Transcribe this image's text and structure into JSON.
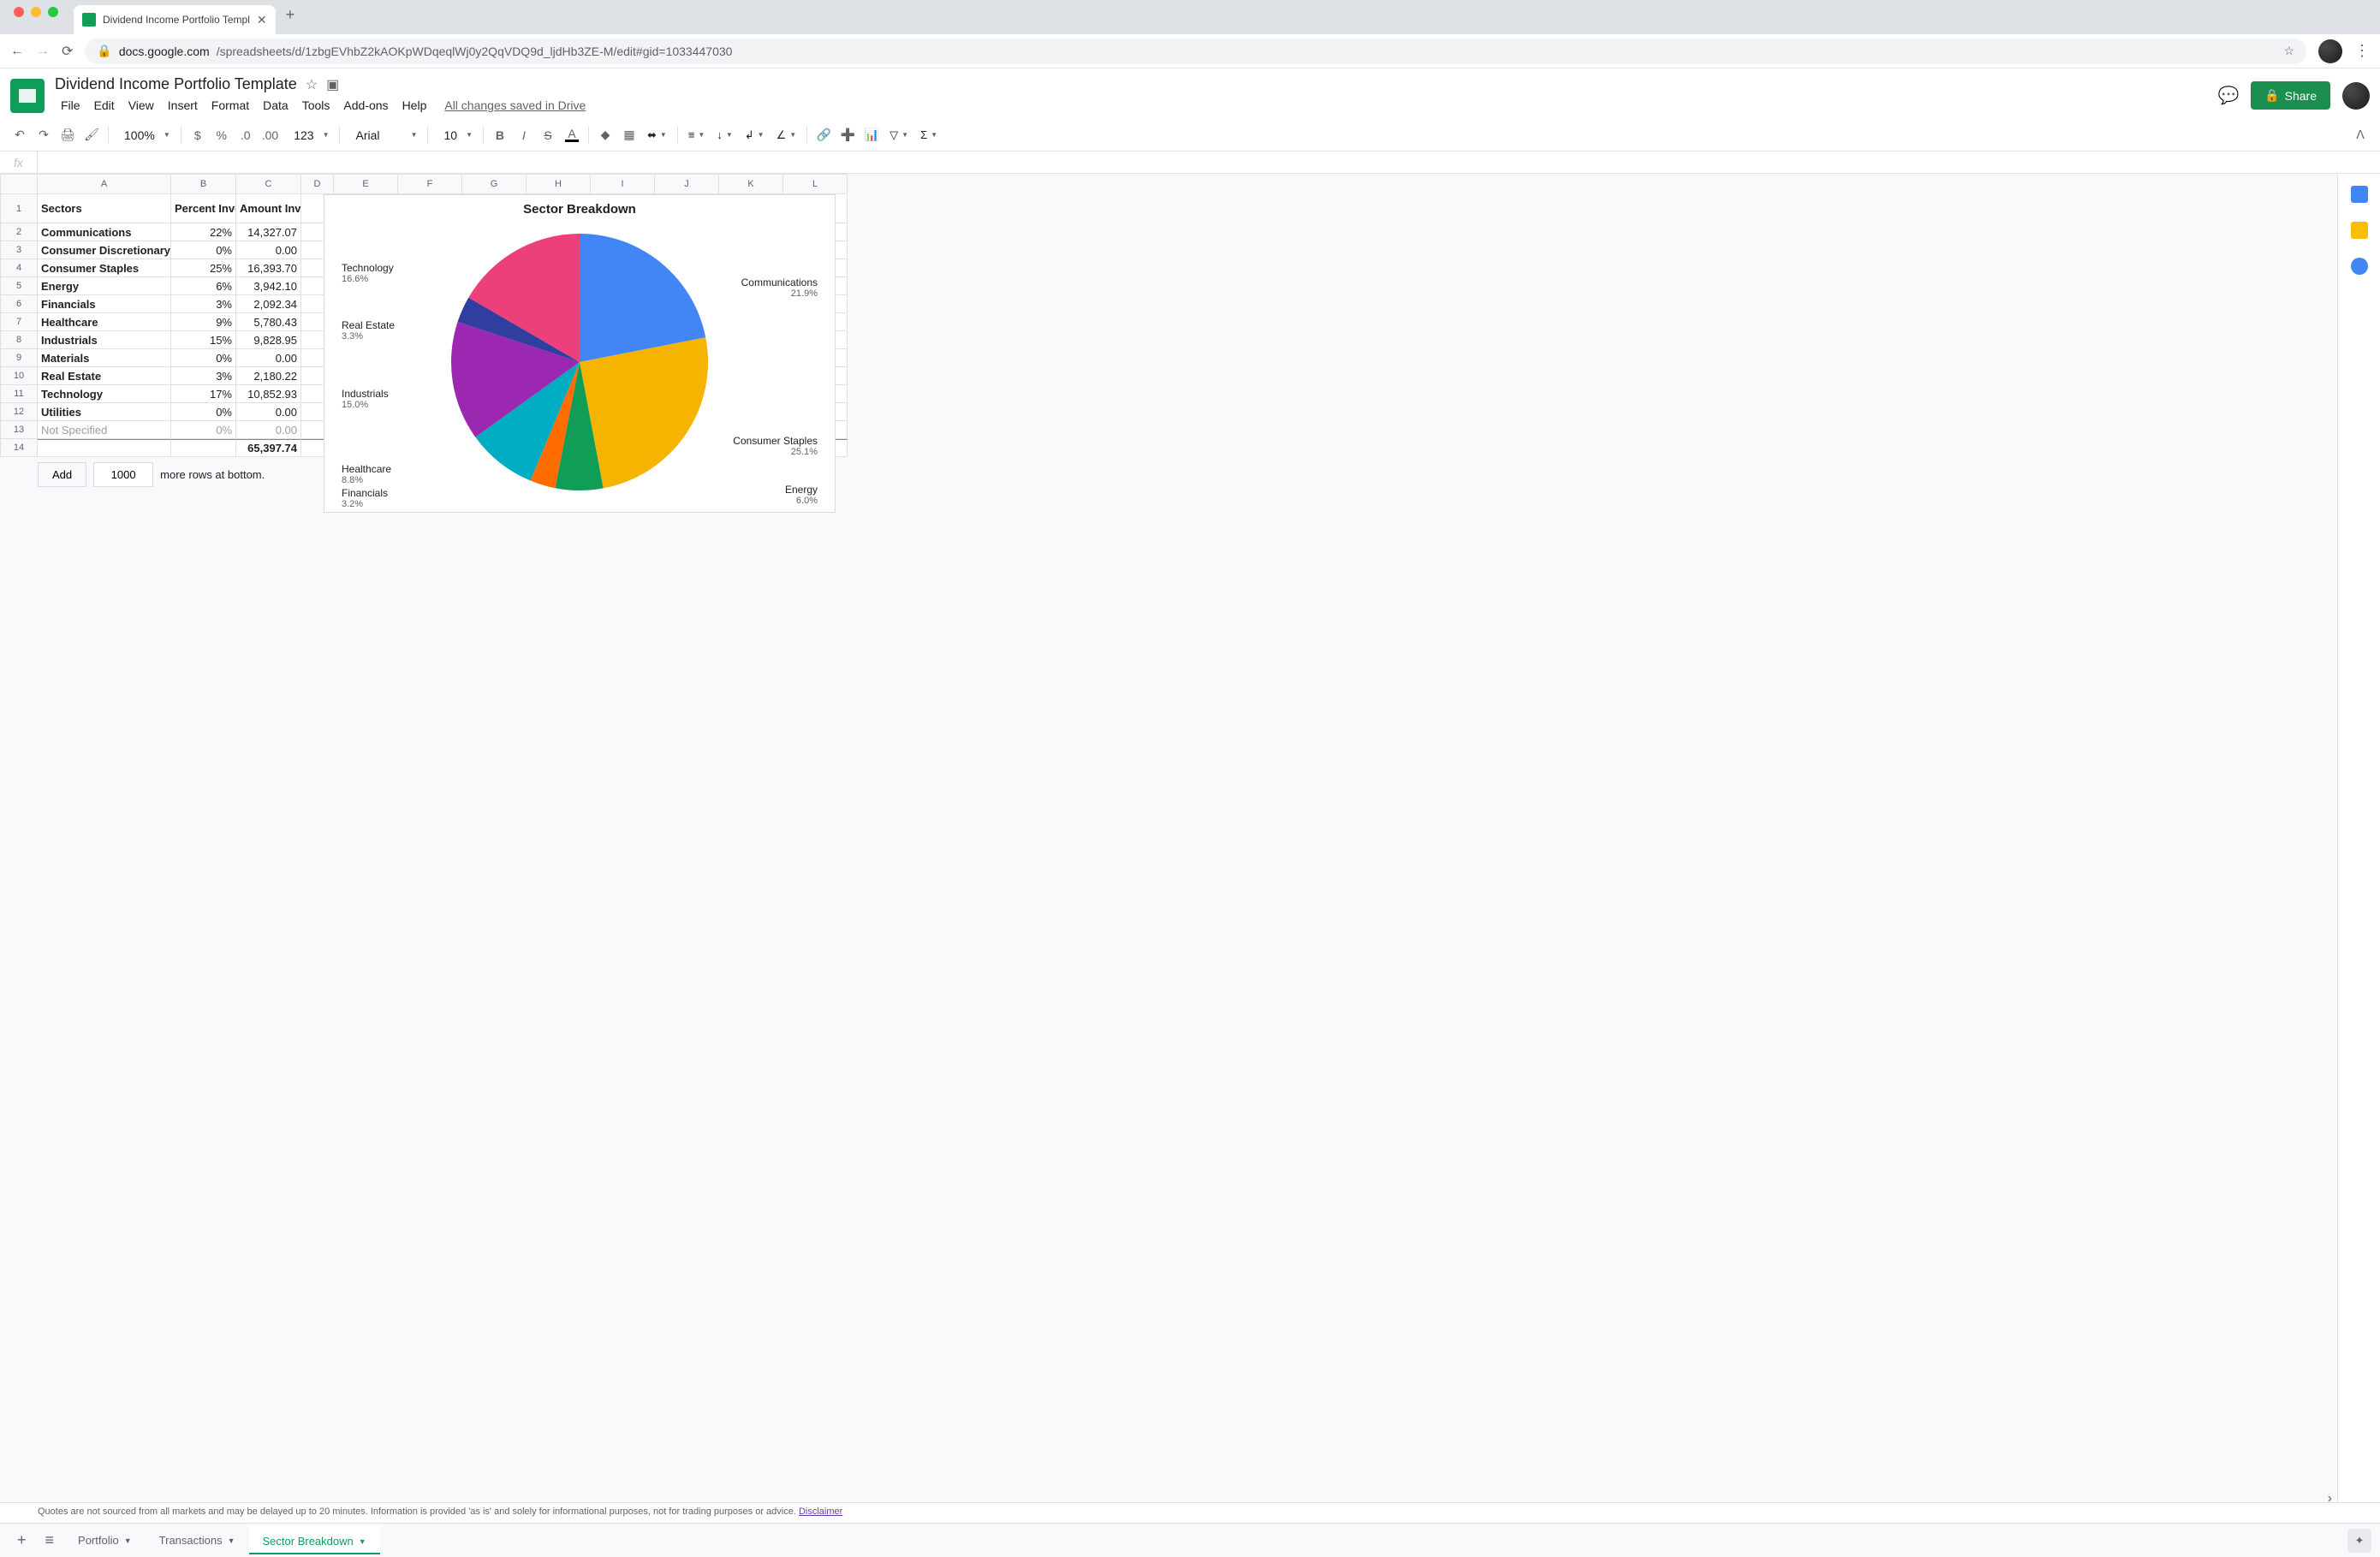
{
  "browser": {
    "tab_title": "Dividend Income Portfolio Templ",
    "url_host": "docs.google.com",
    "url_path": "/spreadsheets/d/1zbgEVhbZ2kAOKpWDqeqlWj0y2QqVDQ9d_ljdHb3ZE-M/edit#gid=1033447030"
  },
  "doc": {
    "title": "Dividend Income Portfolio Template",
    "save_status": "All changes saved in Drive",
    "share_label": "Share"
  },
  "menu": [
    "File",
    "Edit",
    "View",
    "Insert",
    "Format",
    "Data",
    "Tools",
    "Add-ons",
    "Help"
  ],
  "toolbar": {
    "zoom": "100%",
    "font": "Arial",
    "font_size": "10",
    "more_formats": "123"
  },
  "columns": [
    "A",
    "B",
    "C",
    "D",
    "E",
    "F",
    "G",
    "H",
    "I",
    "J",
    "K",
    "L"
  ],
  "col_widths": {
    "A": 156,
    "B": 76,
    "C": 76,
    "D": 38,
    "E": 75,
    "F": 75,
    "G": 75,
    "H": 75,
    "I": 75,
    "J": 75,
    "K": 75,
    "L": 75
  },
  "headers": {
    "A": "Sectors",
    "B": "Percent Invested",
    "C": "Amount Invested"
  },
  "rows": [
    {
      "n": 2,
      "sector": "Communications",
      "pct": "22%",
      "amt": "14,327.07",
      "bold": true
    },
    {
      "n": 3,
      "sector": "Consumer Discretionary",
      "pct": "0%",
      "amt": "0.00",
      "bold": true
    },
    {
      "n": 4,
      "sector": "Consumer Staples",
      "pct": "25%",
      "amt": "16,393.70",
      "bold": true
    },
    {
      "n": 5,
      "sector": "Energy",
      "pct": "6%",
      "amt": "3,942.10",
      "bold": true
    },
    {
      "n": 6,
      "sector": "Financials",
      "pct": "3%",
      "amt": "2,092.34",
      "bold": true
    },
    {
      "n": 7,
      "sector": "Healthcare",
      "pct": "9%",
      "amt": "5,780.43",
      "bold": true
    },
    {
      "n": 8,
      "sector": "Industrials",
      "pct": "15%",
      "amt": "9,828.95",
      "bold": true
    },
    {
      "n": 9,
      "sector": "Materials",
      "pct": "0%",
      "amt": "0.00",
      "bold": true
    },
    {
      "n": 10,
      "sector": "Real Estate",
      "pct": "3%",
      "amt": "2,180.22",
      "bold": true
    },
    {
      "n": 11,
      "sector": "Technology",
      "pct": "17%",
      "amt": "10,852.93",
      "bold": true
    },
    {
      "n": 12,
      "sector": "Utilities",
      "pct": "0%",
      "amt": "0.00",
      "bold": true
    },
    {
      "n": 13,
      "sector": "Not Specified",
      "pct": "0%",
      "amt": "0.00",
      "bold": false,
      "grey": true
    }
  ],
  "total_row": {
    "n": 14,
    "amt": "65,397.74"
  },
  "add_rows": {
    "button": "Add",
    "value": "1000",
    "suffix": "more rows at bottom."
  },
  "chart_data": {
    "type": "pie",
    "title": "Sector Breakdown",
    "series": [
      {
        "name": "Communications",
        "value": 21.9,
        "label": "21.9%",
        "color": "#4285f4"
      },
      {
        "name": "Consumer Staples",
        "value": 25.1,
        "label": "25.1%",
        "color": "#f4b400"
      },
      {
        "name": "Energy",
        "value": 6.0,
        "label": "6.0%",
        "color": "#0f9d58"
      },
      {
        "name": "Financials",
        "value": 3.2,
        "label": "3.2%",
        "color": "#ff6d00"
      },
      {
        "name": "Healthcare",
        "value": 8.8,
        "label": "8.8%",
        "color": "#00acc1"
      },
      {
        "name": "Industrials",
        "value": 15.0,
        "label": "15.0%",
        "color": "#9c27b0"
      },
      {
        "name": "Real Estate",
        "value": 3.3,
        "label": "3.3%",
        "color": "#303f9f"
      },
      {
        "name": "Technology",
        "value": 16.6,
        "label": "16.6%",
        "color": "#ec407a"
      }
    ]
  },
  "disclaimer": {
    "text": "Quotes are not sourced from all markets and may be delayed up to 20 minutes. Information is provided 'as is' and solely for informational purposes, not for trading purposes or advice. ",
    "link": "Disclaimer"
  },
  "sheet_tabs": [
    {
      "name": "Portfolio",
      "active": false
    },
    {
      "name": "Transactions",
      "active": false
    },
    {
      "name": "Sector Breakdown",
      "active": true
    }
  ]
}
